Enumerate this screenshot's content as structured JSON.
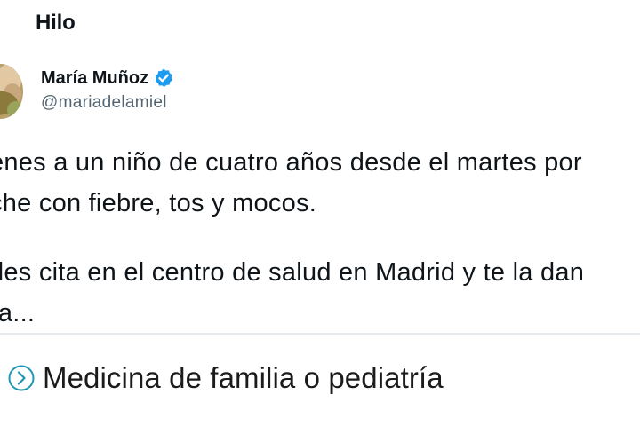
{
  "header": {
    "title": "Hilo"
  },
  "tweet": {
    "author_name": "María Muñoz",
    "handle": "@mariadelamiel",
    "lines": [
      "enes a un niño de cuatro años desde el martes por",
      "che con fiebre, tos y mocos.",
      "des cita en el centro de salud en Madrid y te la dan",
      "ra..."
    ]
  },
  "card": {
    "text": "Medicina de familia o pediatría",
    "icon": "chevron-right-circle-icon"
  },
  "colors": {
    "verified": "#1d9bf0",
    "handle": "#536471",
    "text": "#0f1419",
    "card_icon": "#1f95b5",
    "divider": "#e6ecf0"
  }
}
